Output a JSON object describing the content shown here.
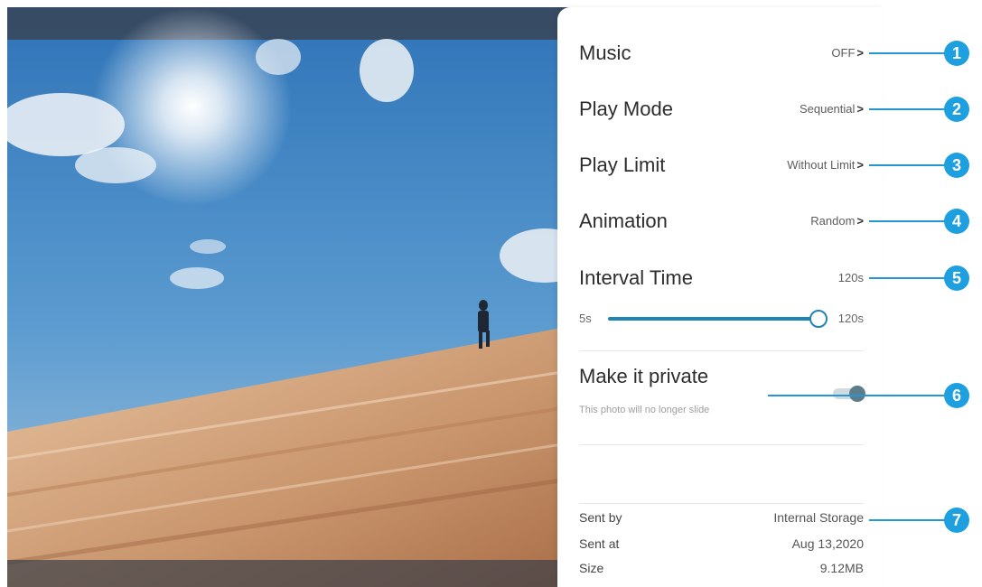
{
  "settings": {
    "music": {
      "label": "Music",
      "value": "OFF"
    },
    "play_mode": {
      "label": "Play Mode",
      "value": "Sequential"
    },
    "play_limit": {
      "label": "Play Limit",
      "value": "Without Limit"
    },
    "animation": {
      "label": "Animation",
      "value": "Random"
    },
    "interval_time": {
      "label": "Interval Time",
      "value": "120s"
    },
    "chevron": ">"
  },
  "slider": {
    "min_label": "5s",
    "max_label": "120s",
    "min": 5,
    "max": 120,
    "value": 120
  },
  "private": {
    "title": "Make it private",
    "subtitle": "This photo will no longer slide",
    "enabled": true
  },
  "info": {
    "sent_by": {
      "label": "Sent by",
      "value": "Internal Storage"
    },
    "sent_at": {
      "label": "Sent at",
      "value": "Aug 13,2020"
    },
    "size": {
      "label": "Size",
      "value": "9.12MB"
    }
  },
  "callouts": [
    "1",
    "2",
    "3",
    "4",
    "5",
    "6",
    "7"
  ],
  "colors": {
    "accent": "#1f86b4",
    "callout": "#1e9fe0"
  }
}
